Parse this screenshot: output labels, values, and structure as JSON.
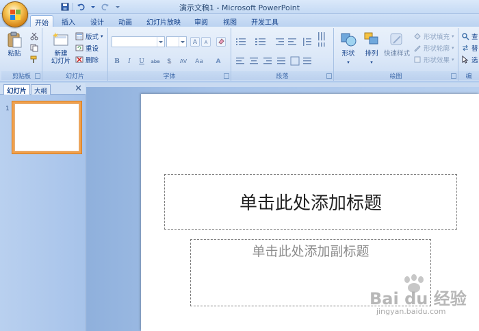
{
  "window": {
    "title": "演示文稿1 - Microsoft PowerPoint"
  },
  "quick_access": [
    {
      "icon": "save-icon"
    },
    {
      "icon": "undo-icon"
    },
    {
      "icon": "redo-icon"
    }
  ],
  "tabs": [
    {
      "label": "开始",
      "active": true
    },
    {
      "label": "插入"
    },
    {
      "label": "设计"
    },
    {
      "label": "动画"
    },
    {
      "label": "幻灯片放映"
    },
    {
      "label": "审阅"
    },
    {
      "label": "视图"
    },
    {
      "label": "开发工具"
    }
  ],
  "ribbon": {
    "clipboard": {
      "label": "剪贴板",
      "paste": "粘贴"
    },
    "slides": {
      "label": "幻灯片",
      "new_slide": "新建\n幻灯片",
      "layout": "版式",
      "reset": "重设",
      "delete": "删除"
    },
    "font": {
      "label": "字体",
      "bold": "B",
      "italic": "I",
      "underline": "U",
      "strike": "abe",
      "shadow": "S",
      "spacing": "AV",
      "case": "Aa",
      "grow": "A",
      "shrink": "A"
    },
    "paragraph": {
      "label": "段落"
    },
    "drawing": {
      "label": "绘图",
      "shapes": "形状",
      "arrange": "排列",
      "quick_styles": "快速样式",
      "shape_fill": "形状填充",
      "shape_outline": "形状轮廓",
      "shape_effects": "形状效果"
    },
    "editing": {
      "label": "编",
      "find": "查",
      "replace": "替",
      "select": "选"
    }
  },
  "left_panel": {
    "tabs": [
      {
        "label": "幻灯片",
        "active": true
      },
      {
        "label": "大纲"
      }
    ],
    "close": "✕",
    "thumbnail_number": "1"
  },
  "slide": {
    "title_placeholder": "单击此处添加标题",
    "subtitle_placeholder": "单击此处添加副标题"
  },
  "watermark": {
    "brand": "Bai du 经验",
    "url": "jingyan.baidu.com"
  },
  "colors": {
    "ribbon_bg": "#dce8f8",
    "accent": "#15428b",
    "thumb_selected": "#f2a14c"
  }
}
